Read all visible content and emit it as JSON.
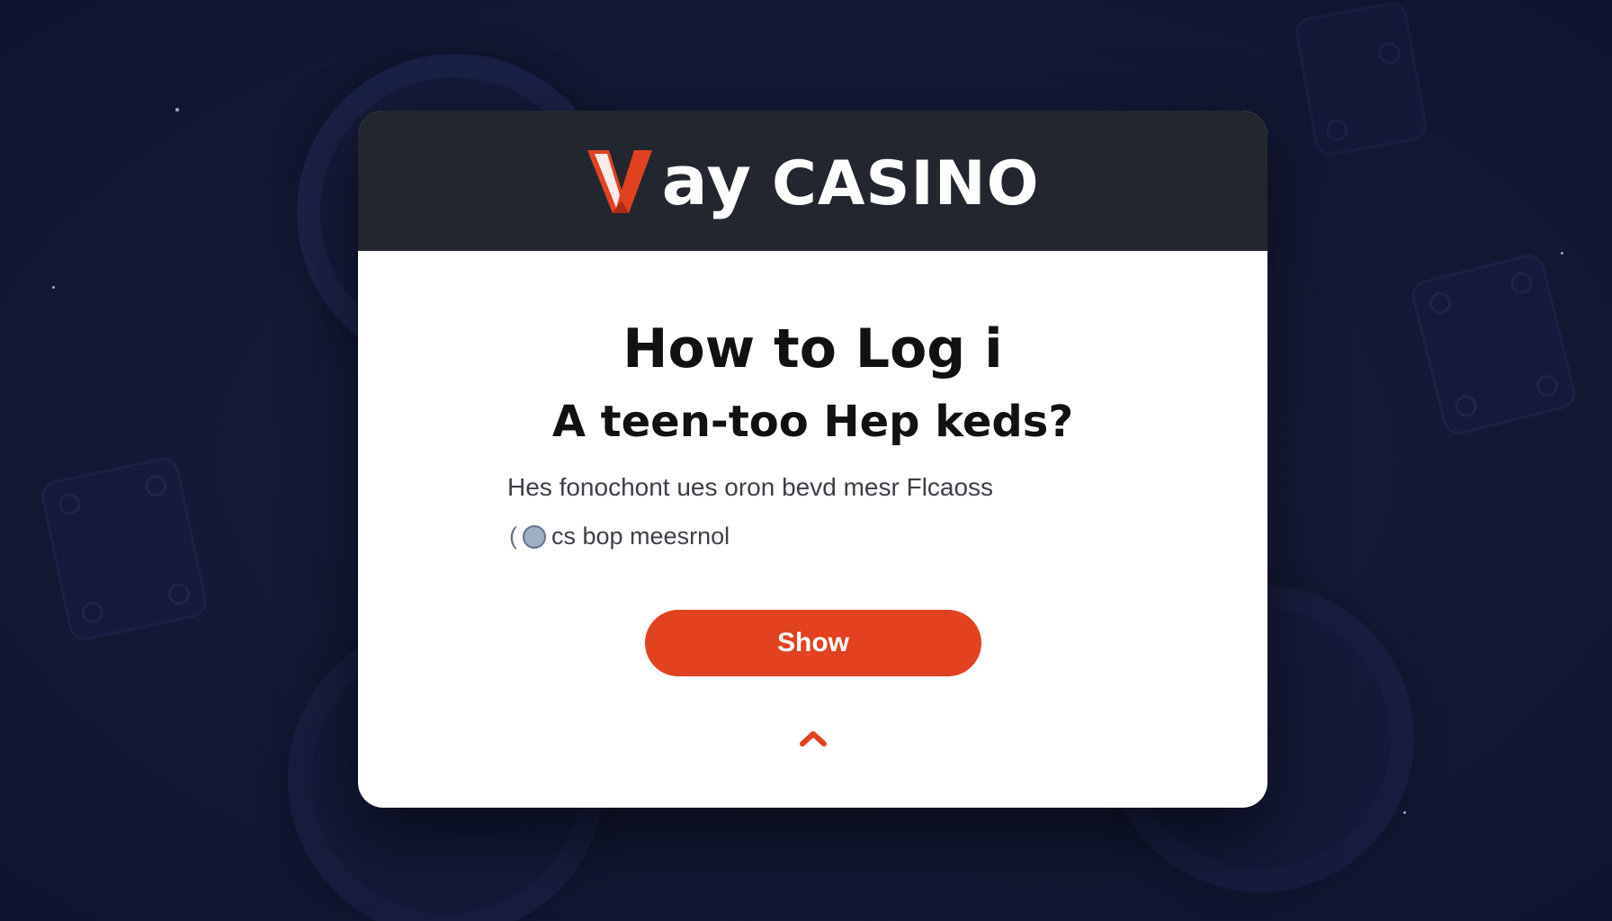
{
  "brand": {
    "logo_letter": "V",
    "logo_text_1": "ay",
    "logo_text_2": "Casino",
    "accent_color": "#e2421f",
    "header_color": "#22262f"
  },
  "dialog": {
    "title": "How to Log i",
    "subtitle": "A teen-too Hep keds?",
    "description": "Hes fonochont ues oron bevd mesr Flcaoss",
    "note_icon": "shield-icon",
    "note_text": "cs bop meesrnol",
    "show_button_label": "Show",
    "collapse_icon": "chevron-up-icon"
  }
}
